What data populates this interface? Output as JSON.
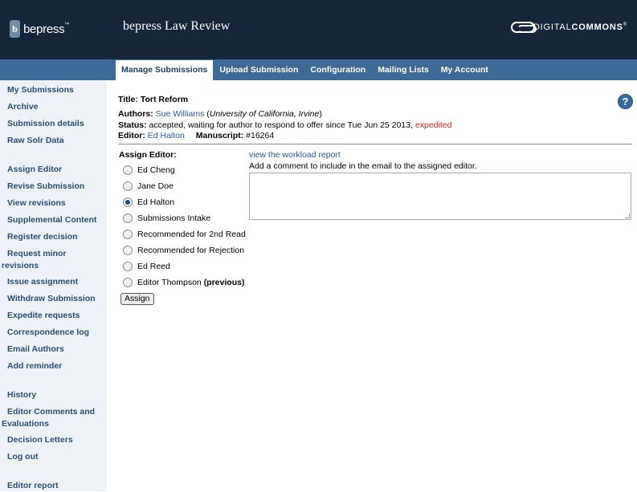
{
  "header": {
    "logo_text": "bepress",
    "logo_tm": "™",
    "logo_mark": "b",
    "site_title": "bepress Law Review",
    "partner_logo_light": "DIGITAL",
    "partner_logo_bold": "COMMONS",
    "partner_logo_reg": "®"
  },
  "tabs": [
    {
      "label": "Manage Submissions",
      "active": true
    },
    {
      "label": "Upload Submission"
    },
    {
      "label": "Configuration"
    },
    {
      "label": "Mailing Lists"
    },
    {
      "label": "My Account"
    }
  ],
  "sidebar": {
    "items": [
      "My Submissions",
      "Archive",
      "Submission details",
      "Raw Solr Data",
      "Assign Editor",
      "Revise Submission",
      "View revisions",
      "Supplemental Content",
      "Register decision",
      "Request minor revisions",
      "Issue assignment",
      "Withdraw Submission",
      "Expedite requests",
      "Correspondence log",
      "Email Authors",
      "Add reminder",
      "History",
      "Editor Comments and Evaluations",
      "Decision Letters",
      "Log out",
      "Editor report"
    ]
  },
  "submission": {
    "title_label": "Title:",
    "title": "Tort Reform",
    "authors_label": "Authors:",
    "author_name": "Sue Williams",
    "author_affiliation": "University of California, Irvine",
    "status_label": "Status:",
    "status_text": "accepted, waiting for author to respond to offer since Tue Jun 25 2013,",
    "status_flag": "expedited",
    "editor_label": "Editor:",
    "editor_name": "Ed Halton",
    "manuscript_label": "Manuscript:",
    "manuscript_number": "#16264"
  },
  "assign": {
    "heading": "Assign Editor:",
    "workload_link": "view the workload report",
    "comment_prompt": "Add a comment to include in the email to the assigned editor.",
    "options": [
      {
        "label": "Ed Cheng",
        "checked": false
      },
      {
        "label": "Jane Doe",
        "checked": false
      },
      {
        "label": "Ed Halton",
        "checked": true
      },
      {
        "label": "Submissions Intake",
        "checked": false
      },
      {
        "label": "Recommended for 2nd Read",
        "checked": false
      },
      {
        "label": "Recommended for Rejection",
        "checked": false
      },
      {
        "label": "Ed Reed",
        "checked": false
      },
      {
        "label": "Editor Thompson",
        "checked": false,
        "suffix": "(previous)"
      }
    ],
    "button_label": "Assign",
    "comment_value": ""
  },
  "icons": {
    "help": "help-icon"
  },
  "colors": {
    "header_bg": "#16263a",
    "nav_bg": "#3f6a96",
    "link": "#2a58a0",
    "sidebar_link": "#2a4e78",
    "expedited": "#d42020"
  }
}
